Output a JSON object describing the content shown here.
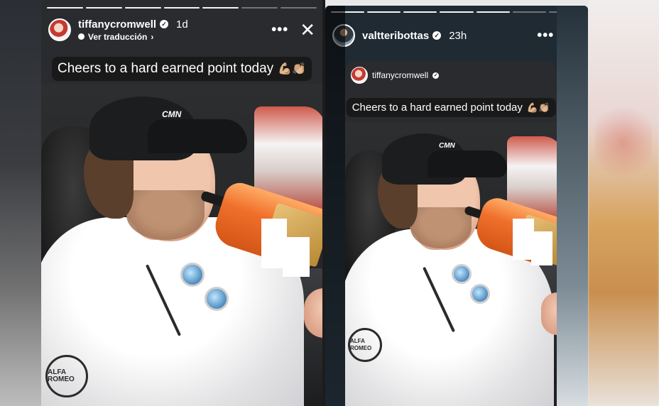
{
  "story_left": {
    "username": "tiffanycromwell",
    "time": "1d",
    "translation_label": "Ver traducción",
    "caption": "Cheers to a hard earned point today",
    "caption_emoji": "💪🏼👏🏼",
    "cap_logo": "CMN",
    "hoodie_logo_top": "ALFA ROMEO",
    "progress_total": 7,
    "progress_done": 5
  },
  "story_right": {
    "username": "valtteribottas",
    "time": "23h",
    "progress_total": 7,
    "progress_done": 5,
    "shared_post": {
      "username": "tiffanycromwell",
      "caption": "Cheers to a hard earned point today",
      "caption_emoji": "💪🏼👏🏼",
      "cap_logo": "CMN",
      "hoodie_logo_top": "ALFA ROMEO"
    }
  },
  "icons": {
    "more": "more-options-icon",
    "close": "close-icon",
    "verified": "verified-badge-icon",
    "translate": "globe-icon"
  },
  "colors": {
    "story_bg": "#2a2b2e",
    "caption_bg": "#141414",
    "text": "#ffffff",
    "bottle": "#ef6f2a"
  }
}
